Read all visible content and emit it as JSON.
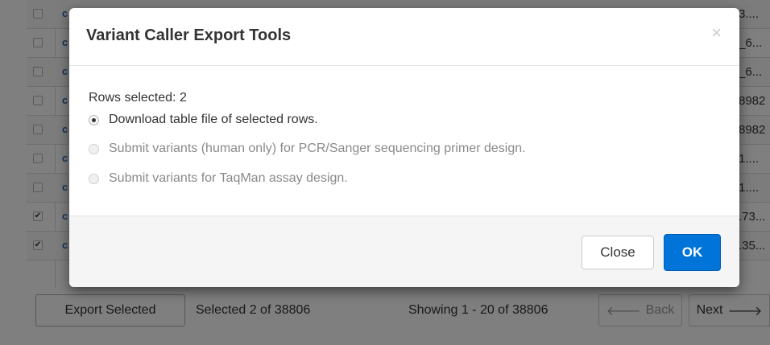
{
  "table": {
    "rows": [
      {
        "link": "c",
        "cell": "3....",
        "checked": false
      },
      {
        "link": "c",
        "cell": "_6...",
        "checked": false
      },
      {
        "link": "c",
        "cell": "_6...",
        "checked": false
      },
      {
        "link": "c",
        "cell": "8982",
        "checked": false
      },
      {
        "link": "c",
        "cell": "8982",
        "checked": false
      },
      {
        "link": "c",
        "cell": "1....",
        "checked": false
      },
      {
        "link": "c",
        "cell": "1....",
        "checked": false
      },
      {
        "link": "c",
        "cell": ".73...",
        "checked": true
      },
      {
        "link": "c",
        "cell": ".35...",
        "checked": true
      }
    ]
  },
  "footer": {
    "export_label": "Export Selected",
    "selected_text": "Selected 2 of 38806",
    "showing_text": "Showing 1 - 20 of 38806",
    "back_label": "Back",
    "next_label": "Next"
  },
  "modal": {
    "title": "Variant Caller Export Tools",
    "close_x": "×",
    "rows_selected": "Rows selected: 2",
    "options": [
      {
        "label": "Download table file of selected rows.",
        "selected": true,
        "enabled": true
      },
      {
        "label": "Submit variants (human only) for PCR/Sanger sequencing primer design.",
        "selected": false,
        "enabled": false
      },
      {
        "label": "Submit variants for TaqMan assay design.",
        "selected": false,
        "enabled": false
      }
    ],
    "close_label": "Close",
    "ok_label": "OK"
  },
  "colors": {
    "primary": "#0074d9",
    "overlay": "rgba(0,0,0,0.5)"
  },
  "icons": {
    "back": "arrow-left-icon",
    "next": "arrow-right-icon",
    "close": "close-icon"
  }
}
